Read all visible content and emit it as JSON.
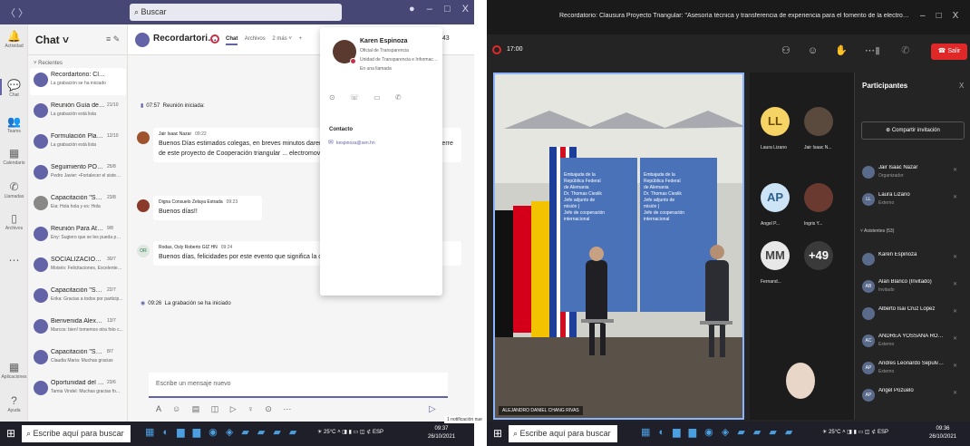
{
  "teams": {
    "search_placeholder": "Buscar",
    "window_controls": [
      "–",
      "□",
      "X"
    ],
    "nav_arrows": "〈 〉",
    "rail": [
      {
        "label": "Actividad",
        "icon": "bell-icon",
        "glyph": "🔔"
      },
      {
        "label": "Chat",
        "icon": "chat-icon",
        "glyph": "💬"
      },
      {
        "label": "Teams",
        "icon": "teams-icon",
        "glyph": "👥"
      },
      {
        "label": "Calendario",
        "icon": "calendar-icon",
        "glyph": "▦"
      },
      {
        "label": "Llamadas",
        "icon": "phone-icon",
        "glyph": "✆"
      },
      {
        "label": "Archivos",
        "icon": "files-icon",
        "glyph": "▯"
      },
      {
        "label": "...",
        "icon": "more-icon",
        "glyph": "⋯"
      },
      {
        "label": "Aplicaciones",
        "icon": "apps-icon",
        "glyph": "▦"
      },
      {
        "label": "Ayuda",
        "icon": "help-icon",
        "glyph": "?"
      }
    ],
    "chat_list_title": "Chat ˅",
    "recent_label": "˅ Recientes",
    "chats": [
      {
        "name": "Recordartorio: Clausura Proy...",
        "time": "",
        "preview": "La grabación se ha iniciado",
        "initials": "",
        "selected": true
      },
      {
        "name": "Reunión Guía de Buenas ...",
        "time": "21/10",
        "preview": "La grabación está lista",
        "initials": ""
      },
      {
        "name": "Formulación Plan Anual ...",
        "time": "12/10",
        "preview": "La grabación está lista",
        "initials": ""
      },
      {
        "name": "Seguimiento POA UT",
        "time": "25/8",
        "preview": "Pedro Javier: •Fortalecer el sistem...",
        "initials": ""
      },
      {
        "name": "Capacitación \"Sector Ener...",
        "time": "23/8",
        "preview": "Eia: Hola hola y es: Hola",
        "initials": ""
      },
      {
        "name": "Reunión Para Atender Reco...",
        "time": "9/8",
        "preview": "Eny: Sugiero que se les pueda pas...",
        "initials": ""
      },
      {
        "name": "SOCIALIZACIÓN DEL INF...",
        "time": "30/7",
        "preview": "Moisés: Felicitaciones, Excelente t...",
        "initials": ""
      },
      {
        "name": "Capacitación \"Sector Ener...",
        "time": "22/7",
        "preview": "Erika: Gracias a todos por particip...",
        "initials": ""
      },
      {
        "name": "Bienvenida Alexandra",
        "time": "13/7",
        "preview": "Marcos: bien! tomemos otra foto c...",
        "initials": ""
      },
      {
        "name": "Capacitación \"Sector Energ...",
        "time": "8/7",
        "preview": "Claudia Maria: Muchas gracias",
        "initials": ""
      },
      {
        "name": "Oportunidad del Hidróge...",
        "time": "23/6",
        "preview": "Tamia Vindel: Muchas gracias fo...",
        "initials": ""
      }
    ],
    "conversation": {
      "title": "Recordartorio: ...",
      "tabs": [
        "Chat",
        "Archivos",
        "2 más ˅",
        "+"
      ],
      "participant_count": "143",
      "system_lines": [
        {
          "time": "07:57",
          "text": "Reunión iniciada:"
        },
        {
          "time": "09:26",
          "text": "La grabación se ha iniciado"
        }
      ],
      "messages": [
        {
          "author": "Jair Isaac Nazar",
          "time": "09:22",
          "initials": "",
          "text": "Buenos Días estimados colegas, en breves minutos daremos comienzo a la... valiosa asistencia al cierre de este proyecto de Cooperación triangular ... electromovilidad en nuestro país."
        },
        {
          "author": "Digna Consuelo Zelaya Estrada",
          "time": "09:23",
          "initials": "",
          "text": "Buenos días!!"
        },
        {
          "author": "Rodas, Osly Roberto GIZ HN",
          "time": "09:24",
          "initials": "OR",
          "text": "Buenos días, felicidades por este evento que significa la continuación ... sector energía."
        }
      ],
      "compose_placeholder": "Escribe un mensaje nuevo",
      "compose_tools": "A ☺ ▤ ◫ ▷ ♀ ⊙ ⋯",
      "send_glyph": "▷"
    },
    "profile_card": {
      "name": "Karen Espinoza",
      "role": "Oficial de Transparencia",
      "department": "Unidad de Transparencia e Informaci...",
      "status": "En una llamada",
      "actions": "⊙ ☏ ▭ ✆",
      "contact_heading": "Contacto",
      "email": "kespinoza@sen.hn"
    },
    "taskbar": {
      "search_placeholder": "Escribe aquí para buscar",
      "temperature": "25°C",
      "clock_time": "09:37",
      "clock_date": "26/10/2021",
      "lang": "ESP"
    }
  },
  "zoom": {
    "window_title": "Recordatorio: Clausura Proyecto Triangular: \"Asesoría técnica y transferencia de experiencia para el fomento de la electromovilidad en Honduras\",",
    "window_controls": [
      "–",
      "□",
      "X"
    ],
    "elapsed_time": "17:00",
    "leave_label": "Salir",
    "stage_label": "ALEJANDRO DANIEL CHANG RIVAS",
    "banner_lines": [
      "Embajada de la",
      "República Federal",
      "de Alemania",
      "Dr. Thomas Cieslik",
      "Jefe adjunto de",
      "misión |",
      "Jefe de cooperación",
      "internacional"
    ],
    "tiles": [
      {
        "initials": "LL",
        "caption": "Laura Lizano",
        "bg": "#f6d365",
        "fg": "#6b4a00",
        "photo": false
      },
      {
        "initials": "",
        "caption": "Jair Isaac N...",
        "bg": "#5a4a3e",
        "fg": "#fff",
        "photo": true
      },
      {
        "initials": "AP",
        "caption": "Angel P...",
        "bg": "#cde4f7",
        "fg": "#2c5f8a",
        "photo": false
      },
      {
        "initials": "",
        "caption": "Ingris Y...",
        "bg": "#6a3a30",
        "fg": "#fff",
        "photo": true
      },
      {
        "initials": "MM",
        "caption": "Fernand...",
        "bg": "#e8e8e8",
        "fg": "#444",
        "photo": false
      },
      {
        "initials": "+49",
        "caption": "",
        "bg": "#3a3a3a",
        "fg": "#fff",
        "photo": false
      }
    ],
    "participants_panel": {
      "title": "Participantes",
      "close_glyph": "X",
      "invite_label": "⊕ Compartir invitación",
      "hosts": [
        {
          "name": "Jair Isaac Nazar",
          "sub": "Organizador",
          "initials": ""
        },
        {
          "name": "Laura Lizano",
          "sub": "Externo",
          "initials": "LL"
        }
      ],
      "attendees_label": "˅ Asistentes (53)",
      "attendees": [
        {
          "name": "Karen Espinoza",
          "sub": "",
          "initials": ""
        },
        {
          "name": "Alan Blanco (Invitado)",
          "sub": "Invitado",
          "initials": "AB"
        },
        {
          "name": "Alberto Isai Cruz Lopez",
          "sub": "",
          "initials": ""
        },
        {
          "name": "ANDREA YOSSANA ROD...",
          "sub": "Externo",
          "initials": "AC"
        },
        {
          "name": "Andres Leonardo Sepulve...",
          "sub": "Externo",
          "initials": "AP"
        },
        {
          "name": "Angel Pozuelo",
          "sub": "",
          "initials": "AP"
        }
      ],
      "notification": "1 notificación nue"
    },
    "taskbar": {
      "search_placeholder": "Escribe aquí para buscar",
      "temperature": "25°C",
      "clock_time": "09:36",
      "clock_date": "26/10/2021",
      "lang": "ESP"
    }
  }
}
